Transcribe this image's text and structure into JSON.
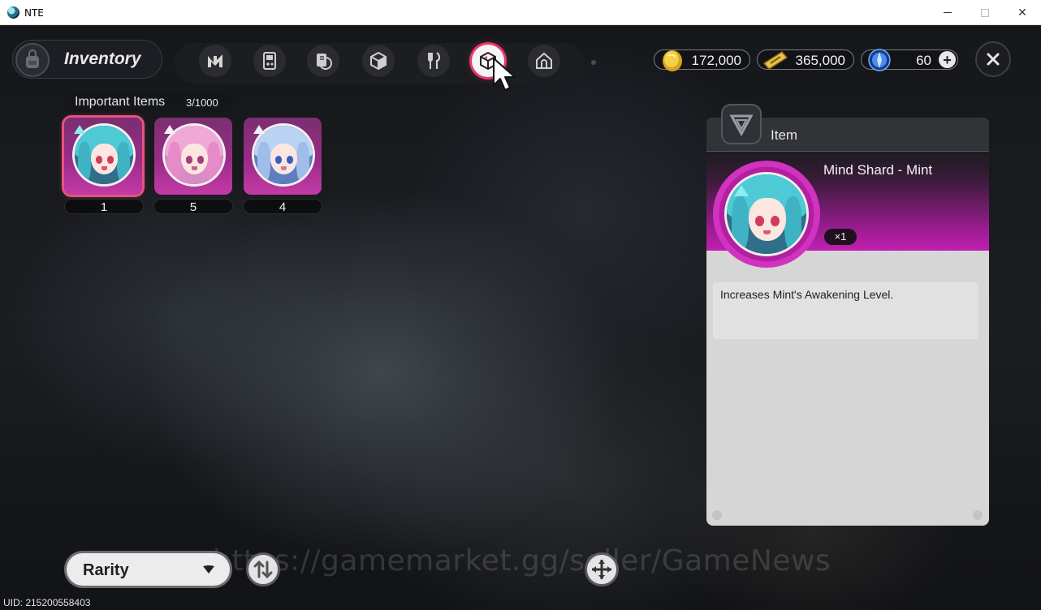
{
  "window": {
    "title": "NTE",
    "minimize_label": "—",
    "maximize_label": "☐",
    "close_label": "✕"
  },
  "header": {
    "title": "Inventory",
    "tabs": [
      {
        "icon": "nte-logo-icon",
        "active": false
      },
      {
        "icon": "gameboy-icon",
        "active": false
      },
      {
        "icon": "cards-icon",
        "active": false
      },
      {
        "icon": "box-icon",
        "active": false
      },
      {
        "icon": "fork-knife-icon",
        "active": false
      },
      {
        "icon": "important-cube-icon",
        "active": true
      },
      {
        "icon": "home-icon",
        "active": false
      }
    ],
    "currencies": [
      {
        "icon": "gold-coin-icon",
        "value": "172,000"
      },
      {
        "icon": "ticket-icon",
        "value": "365,000"
      },
      {
        "icon": "blue-crystal-icon",
        "value": "60"
      }
    ],
    "add_label": "+",
    "close_label": "✕"
  },
  "section": {
    "label": "Important Items",
    "count": "3/1000"
  },
  "items": [
    {
      "name": "Mind Shard - Mint",
      "quantity": "1",
      "selected": true
    },
    {
      "name": "",
      "quantity": "5",
      "selected": false
    },
    {
      "name": "",
      "quantity": "4",
      "selected": false
    }
  ],
  "detail": {
    "header": "Item",
    "name": "Mind Shard - Mint",
    "count": "×1",
    "description": "Increases Mint's Awakening Level."
  },
  "footer": {
    "sort_label": "Rarity",
    "uid": "UID:  215200558403"
  },
  "watermark": "https://gamemarket.gg/seller/GameNews",
  "colors": {
    "accent": "#e9376c",
    "rarity_purple": "#c33aa7",
    "panel_bg": "#d6d6d6"
  }
}
